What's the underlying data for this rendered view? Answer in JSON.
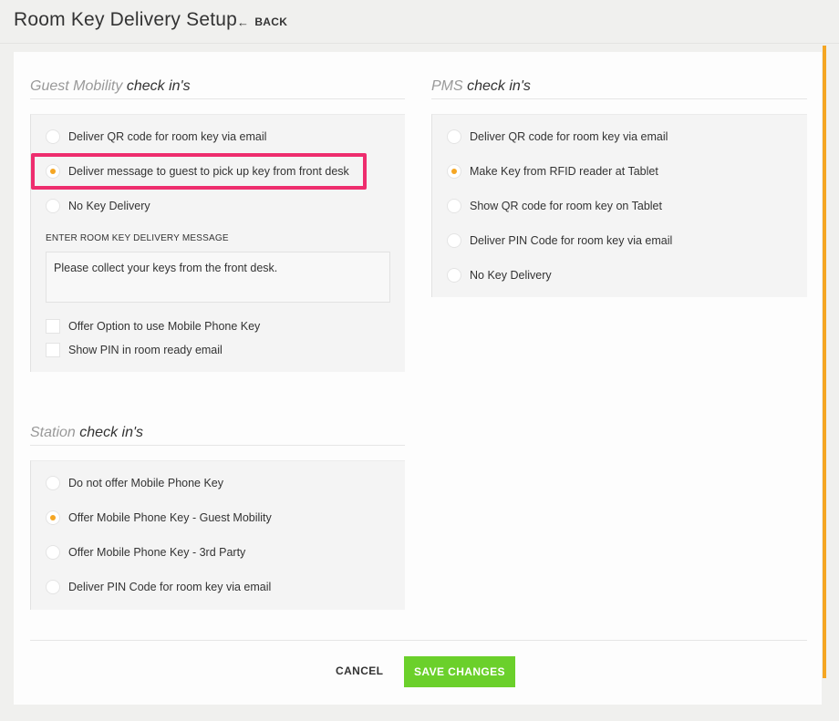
{
  "header": {
    "title": "Room Key Delivery Setup",
    "back_label": "BACK",
    "back_icon": "arrow-left-icon"
  },
  "guest_mobility": {
    "title_light": "Guest Mobility",
    "title_dark": "check in's",
    "options": [
      {
        "label": "Deliver QR code for room key via email",
        "selected": false
      },
      {
        "label": "Deliver message to guest to pick up key from front desk",
        "selected": true
      },
      {
        "label": "No Key Delivery",
        "selected": false
      }
    ],
    "message_label": "ENTER ROOM KEY DELIVERY MESSAGE",
    "message_value": "Please collect your keys from the front desk.",
    "checkboxes": [
      {
        "label": "Offer Option to use Mobile Phone Key",
        "checked": false
      },
      {
        "label": "Show PIN in room ready email",
        "checked": false
      }
    ]
  },
  "pms": {
    "title_light": "PMS",
    "title_dark": "check in's",
    "options": [
      {
        "label": "Deliver QR code for room key via email",
        "selected": false
      },
      {
        "label": "Make Key from RFID reader at Tablet",
        "selected": true
      },
      {
        "label": "Show QR code for room key on Tablet",
        "selected": false
      },
      {
        "label": "Deliver PIN Code for room key via email",
        "selected": false
      },
      {
        "label": "No Key Delivery",
        "selected": false
      }
    ]
  },
  "station": {
    "title_light": "Station",
    "title_dark": "check in's",
    "options": [
      {
        "label": "Do not offer Mobile Phone Key",
        "selected": false
      },
      {
        "label": "Offer Mobile Phone Key - Guest Mobility",
        "selected": true
      },
      {
        "label": "Offer Mobile Phone Key - 3rd Party",
        "selected": false
      },
      {
        "label": "Deliver PIN Code for room key via email",
        "selected": false
      }
    ]
  },
  "footer": {
    "cancel_label": "CANCEL",
    "save_label": "SAVE CHANGES"
  },
  "colors": {
    "accent": "#f5a623",
    "save": "#6bd02b",
    "highlight": "#ee2d6e"
  }
}
